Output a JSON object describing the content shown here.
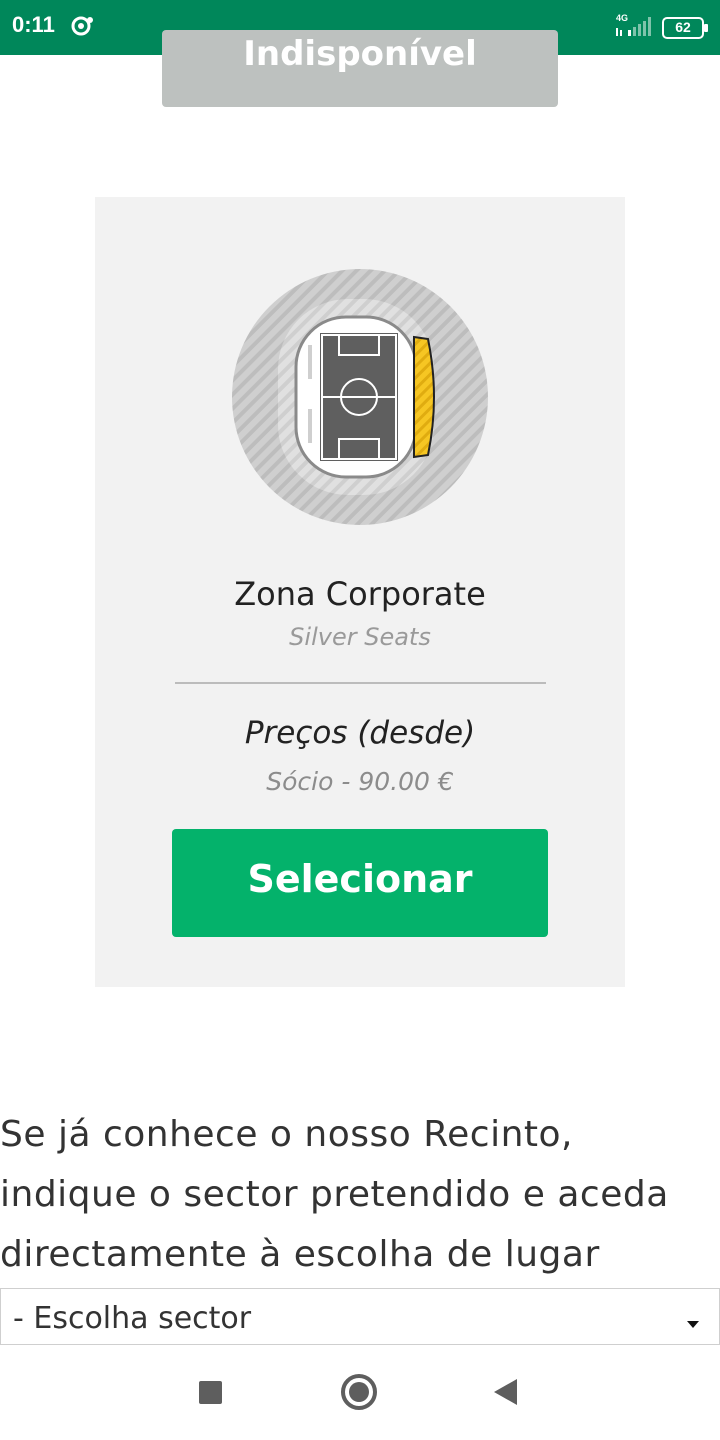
{
  "status_bar": {
    "time": "0:11",
    "network": "4G",
    "battery": "62"
  },
  "top_button": {
    "label": "Indisponível"
  },
  "card": {
    "zone_title": "Zona Corporate",
    "zone_subtitle": "Silver Seats",
    "prices_title": "Preços (desde)",
    "prices_value": "Sócio - 90.00 €",
    "select_label": "Selecionar",
    "highlight_color": "#f6c623"
  },
  "info": {
    "text": "Se já conhece o nosso Recinto, indique o sector pretendido e aceda directamente à escolha de lugar"
  },
  "sector_select": {
    "selected": "- Escolha sector"
  },
  "colors": {
    "status_bar": "#00875a",
    "select_button": "#04b26b",
    "disabled_button": "#bdc1bf"
  }
}
